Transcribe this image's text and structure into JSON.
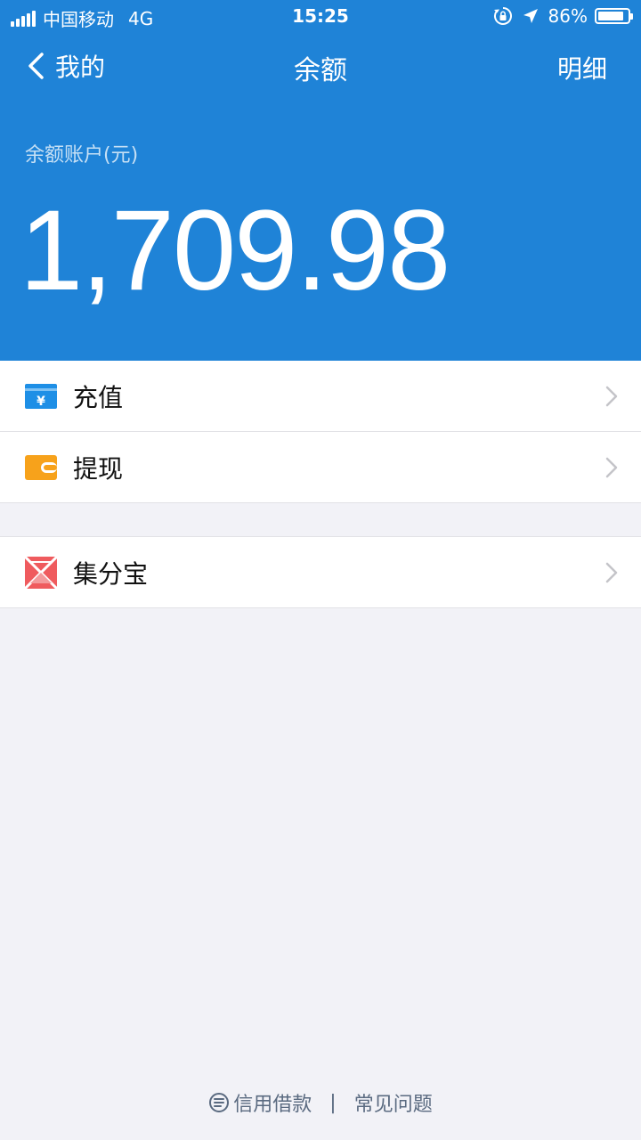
{
  "status_bar": {
    "carrier": "中国移动",
    "network": "4G",
    "time": "15:25",
    "battery_percent": "86%",
    "battery_level": 0.86
  },
  "nav": {
    "back_label": "我的",
    "title": "余额",
    "detail_label": "明细"
  },
  "balance": {
    "account_label": "余额账户(元)",
    "amount": "1,709.98"
  },
  "list": {
    "recharge_label": "充值",
    "withdraw_label": "提现",
    "jifenbao_label": "集分宝"
  },
  "footer": {
    "credit_loan_label": "信用借款",
    "divider": "|",
    "faq_label": "常见问题"
  },
  "colors": {
    "header_bg": "#1f83d7",
    "recharge_icon": "#1e8fe6",
    "withdraw_icon": "#f7a21b",
    "jifenbao_icon": "#ef5b5e"
  }
}
